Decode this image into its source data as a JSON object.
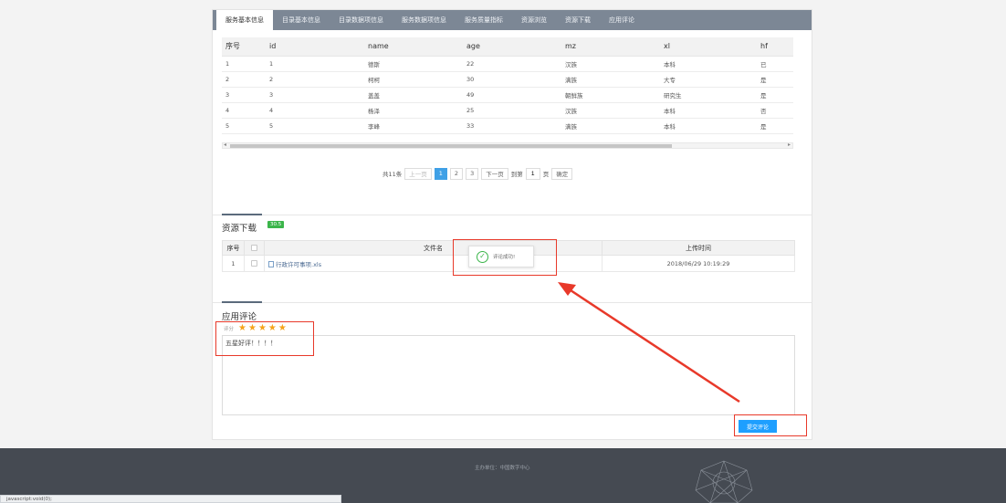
{
  "tabs": [
    "服务基本信息",
    "目录基本信息",
    "目录数据项信息",
    "服务数据项信息",
    "服务质量指标",
    "资源浏览",
    "资源下载",
    "应用评论"
  ],
  "table": {
    "headers": [
      "序号",
      "id",
      "name",
      "age",
      "mz",
      "xl",
      "hf"
    ],
    "rows": [
      [
        "1",
        "1",
        "德斯",
        "22",
        "汉族",
        "本科",
        "已"
      ],
      [
        "2",
        "2",
        "柯柯",
        "30",
        "满族",
        "大专",
        "是"
      ],
      [
        "3",
        "3",
        "盖盖",
        "49",
        "朝鲜族",
        "研究生",
        "是"
      ],
      [
        "4",
        "4",
        "杨泽",
        "25",
        "汉族",
        "本科",
        "否"
      ],
      [
        "5",
        "5",
        "李峰",
        "33",
        "满族",
        "本科",
        "是"
      ]
    ]
  },
  "pager": {
    "total": "共11条",
    "prev": "上一页",
    "pages": [
      "1",
      "2",
      "3"
    ],
    "current": "1",
    "next": "下一页",
    "goto_label": "到第",
    "goto_value": "1",
    "page_unit": "页",
    "confirm": "确定"
  },
  "resources": {
    "title": "资源下载",
    "badge": "30.5",
    "headers": [
      "序号",
      "",
      "文件名",
      "上传时间"
    ],
    "rows": [
      {
        "index": "1",
        "filename": "行政许可事项.xls",
        "time": "2018/06/29 10:19:29"
      }
    ]
  },
  "toast": {
    "message": "评论成功!"
  },
  "comment": {
    "title": "应用评论",
    "rating_label": "评分",
    "stars": 5,
    "text": "五星好评！！！！",
    "submit": "提交评论"
  },
  "footer": {
    "text": "主办单位：中国数字中心"
  },
  "status_bar": {
    "text": "javascript:void(0);"
  },
  "colors": {
    "accent": "#1e9fff",
    "highlight": "#e8392a",
    "star": "#f5a31a",
    "badge": "#3bb54a"
  }
}
